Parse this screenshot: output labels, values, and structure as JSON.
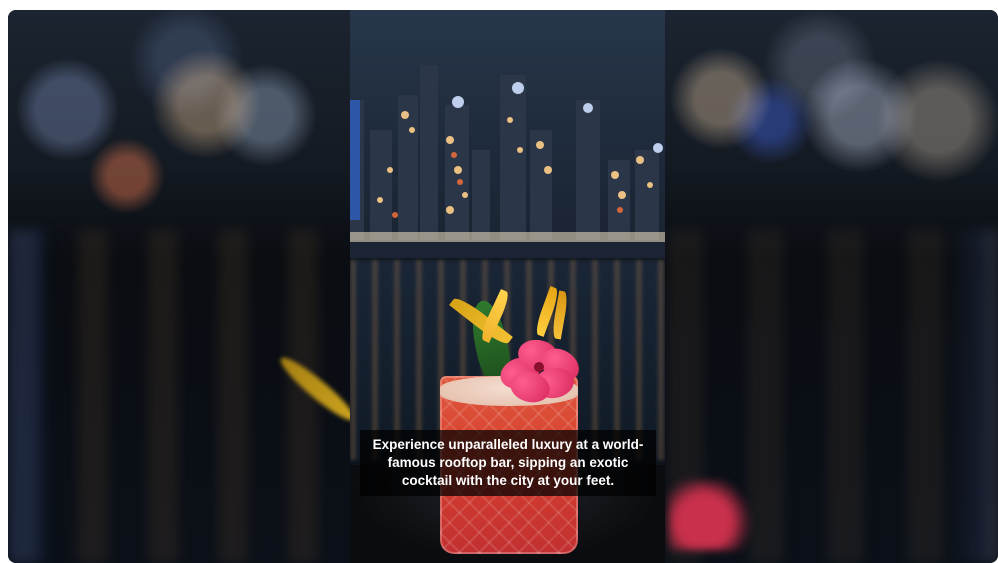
{
  "video": {
    "caption": "Experience unparalleled luxury at a world-famous rooftop bar, sipping an exotic cocktail with the city at your feet."
  },
  "colors": {
    "caption_bg": "#000000",
    "caption_text": "#ffffff",
    "cocktail": "#d6402d",
    "flower": "#e2306b",
    "leaf": "#e8b020"
  },
  "icons": {
    "scene": "city-night-cocktail-image"
  }
}
